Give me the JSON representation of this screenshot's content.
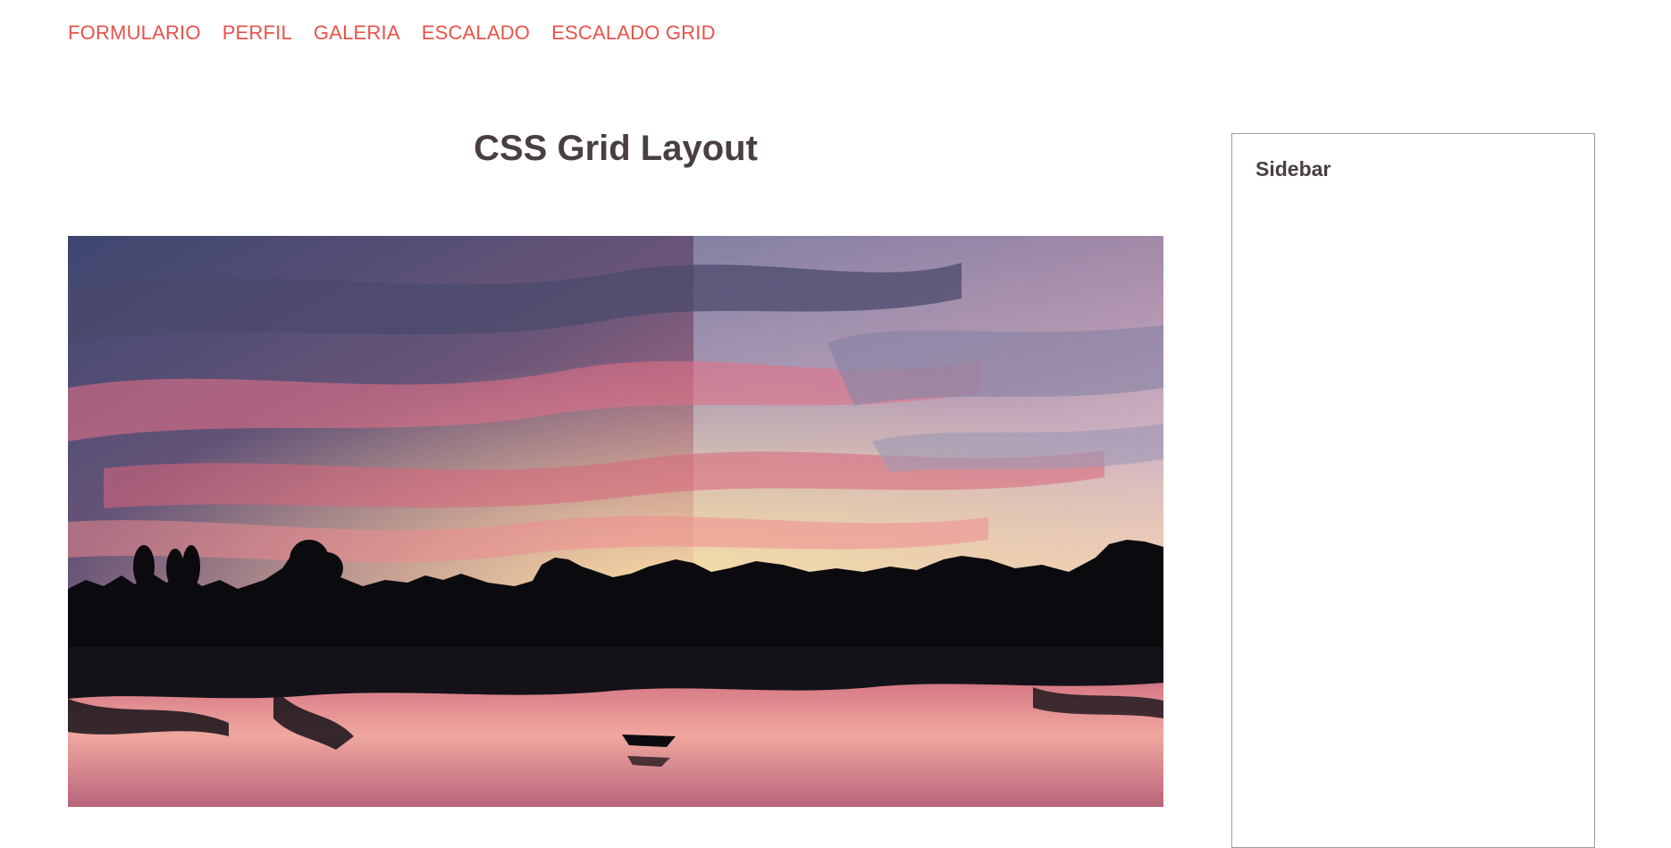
{
  "nav": {
    "items": [
      {
        "label": "FORMULARIO"
      },
      {
        "label": "PERFIL"
      },
      {
        "label": "GALERIA"
      },
      {
        "label": "ESCALADO"
      },
      {
        "label": "ESCALADO GRID"
      }
    ],
    "link_color": "#e8524a"
  },
  "main": {
    "title": "CSS Grid Layout",
    "hero_image": "sunset-river-photo"
  },
  "sidebar": {
    "title": "Sidebar"
  },
  "colors": {
    "text": "#4a3f3f",
    "border": "#9e9e9e"
  }
}
